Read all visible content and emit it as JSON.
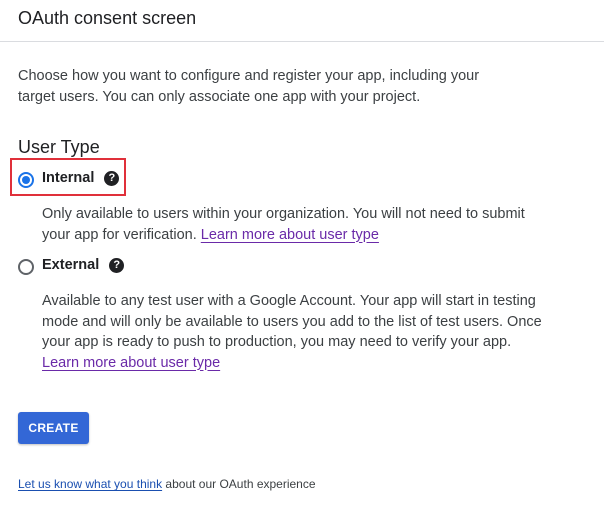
{
  "header": {
    "title": "OAuth consent screen"
  },
  "intro": "Choose how you want to configure and register your app, including your target users. You can only associate one app with your project.",
  "user_type": {
    "title": "User Type",
    "options": [
      {
        "label": "Internal",
        "selected": true,
        "help_icon": "question-help-icon",
        "description": "Only available to users within your organization. You will not need to submit your app for verification.",
        "link": "Learn more about user type"
      },
      {
        "label": "External",
        "selected": false,
        "help_icon": "question-help-icon",
        "description": "Available to any test user with a Google Account. Your app will start in testing mode and will only be available to users you add to the list of test users. Once your app is ready to push to production, you may need to verify your app.",
        "link": "Learn more about user type"
      }
    ],
    "help_glyph": "?"
  },
  "actions": {
    "create_label": "CREATE"
  },
  "feedback": {
    "link": "Let us know what you think",
    "text": " about our OAuth experience"
  },
  "colors": {
    "accent": "#1a73e8",
    "button": "#3367d6",
    "link_visited": "#6a2aa8",
    "highlight": "#e0303a"
  }
}
